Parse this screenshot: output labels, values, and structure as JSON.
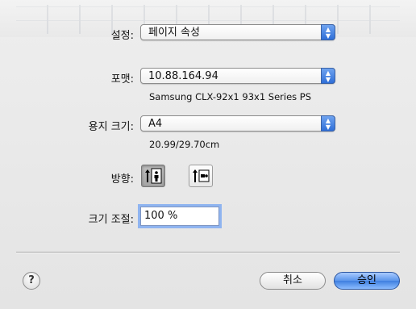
{
  "settings": {
    "label": "설정:",
    "value": "페이지 속성"
  },
  "format_for": {
    "label": "포맷:",
    "value": "10.88.164.94",
    "printer_name": "Samsung CLX-92x1 93x1 Series PS"
  },
  "paper_size": {
    "label": "용지 크기:",
    "value": "A4",
    "dimensions": "20.99/29.70cm"
  },
  "orientation": {
    "label": "방향:",
    "selected": "portrait"
  },
  "scale": {
    "label": "크기 조절:",
    "value": "100 %"
  },
  "buttons": {
    "help": "?",
    "cancel": "취소",
    "ok": "승인"
  },
  "colors": {
    "accent": "#3f7fe0",
    "focus_ring": "#8fb4f0"
  }
}
